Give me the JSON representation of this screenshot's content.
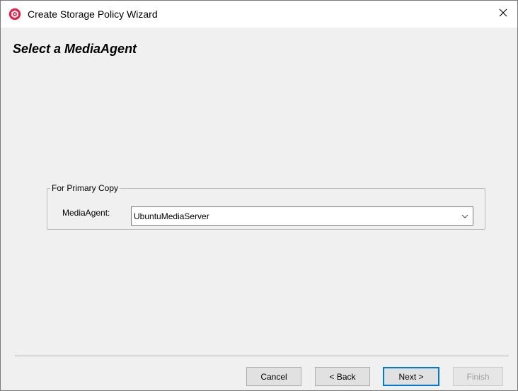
{
  "window": {
    "title": "Create Storage Policy Wizard",
    "app_icon": "commvault-logo-icon",
    "close_icon": "close-icon"
  },
  "page": {
    "heading": "Select a MediaAgent"
  },
  "primary_copy": {
    "legend": "For Primary Copy",
    "media_agent_label": "MediaAgent:",
    "media_agent_value": "UbuntuMediaServer",
    "dropdown_icon": "chevron-down-icon"
  },
  "buttons": {
    "cancel": "Cancel",
    "back": "< Back",
    "next": "Next >",
    "finish": "Finish"
  },
  "colors": {
    "accent": "#0078d7",
    "brand": "#e0224b",
    "background": "#f0f0f0"
  }
}
